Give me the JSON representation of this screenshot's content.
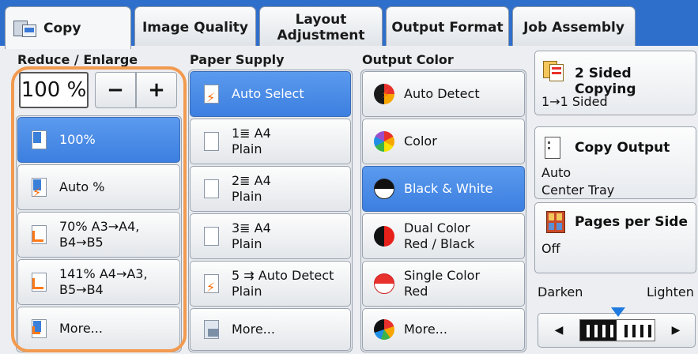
{
  "tabs": [
    {
      "label": "Copy"
    },
    {
      "label": "Image Quality"
    },
    {
      "label": "Layout\nAdjustment"
    },
    {
      "label": "Output Format"
    },
    {
      "label": "Job Assembly"
    }
  ],
  "reduce_enlarge": {
    "label": "Reduce / Enlarge",
    "value": "100 %",
    "minus": "−",
    "plus": "+",
    "options": [
      {
        "line1": "100%",
        "line2": ""
      },
      {
        "line1": "Auto %",
        "line2": ""
      },
      {
        "line1": "70% A3→A4,",
        "line2": "B4→B5"
      },
      {
        "line1": "141% A4→A3,",
        "line2": "B5→B4"
      },
      {
        "line1": "More...",
        "line2": ""
      }
    ]
  },
  "paper_supply": {
    "label": "Paper Supply",
    "options": [
      {
        "line1": "Auto Select",
        "line2": ""
      },
      {
        "line1": "1≣ A4",
        "line2": "Plain"
      },
      {
        "line1": "2≣ A4",
        "line2": "Plain"
      },
      {
        "line1": "3≣ A4",
        "line2": "Plain"
      },
      {
        "line1": "5 ⇉ Auto Detect",
        "line2": "Plain"
      },
      {
        "line1": "More...",
        "line2": ""
      }
    ]
  },
  "output_color": {
    "label": "Output Color",
    "options": [
      {
        "line1": "Auto Detect",
        "line2": ""
      },
      {
        "line1": "Color",
        "line2": ""
      },
      {
        "line1": "Black & White",
        "line2": ""
      },
      {
        "line1": "Dual Color",
        "line2": "Red / Black"
      },
      {
        "line1": "Single Color",
        "line2": "Red"
      },
      {
        "line1": "More...",
        "line2": ""
      }
    ]
  },
  "two_sided": {
    "title": "2 Sided Copying",
    "value": "1→1 Sided"
  },
  "copy_output": {
    "title": "Copy Output",
    "value1": "Auto",
    "value2": "Center Tray"
  },
  "pages_per_side": {
    "title": "Pages per Side",
    "value": "Off"
  },
  "density": {
    "darken": "Darken",
    "lighten": "Lighten",
    "left_arrow": "◀",
    "right_arrow": "▶"
  },
  "colors": {
    "tab_bar": "#2f6fcc",
    "selected": "#3c7fe0",
    "highlight_ring": "#f29a4f"
  }
}
